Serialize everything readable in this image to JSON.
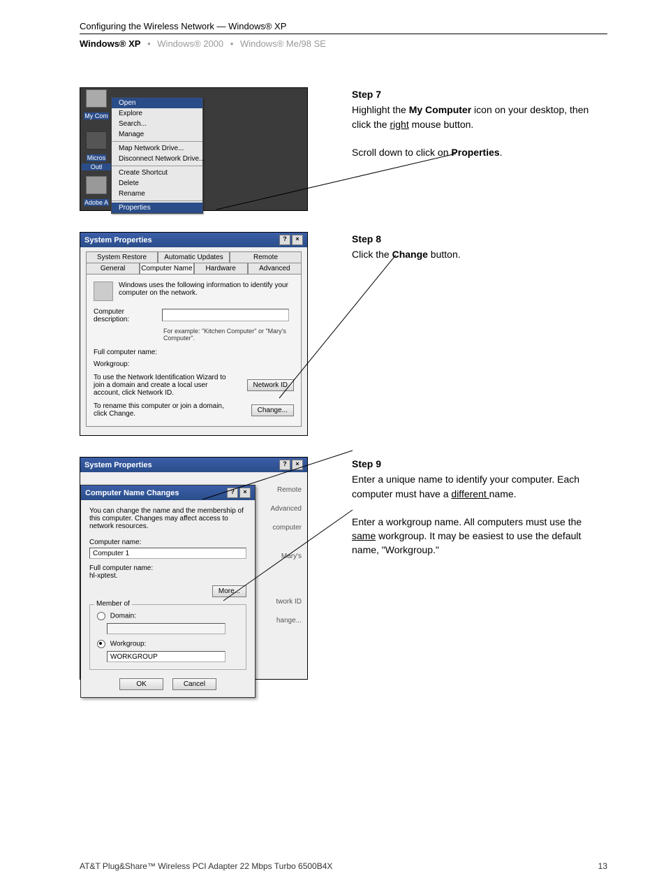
{
  "header": {
    "title": "Configuring the Wireless Network — Windows® XP",
    "tabs": {
      "active": "Windows® XP",
      "t2": "Windows® 2000",
      "t3": "Windows® Me/98 SE"
    }
  },
  "step7": {
    "title": "Step 7",
    "line1a": "Highlight the ",
    "line1b": "My Computer",
    "line1c": " icon on your desktop, then click the ",
    "line1d": "right",
    "line1e": " mouse button.",
    "line2a": "Scroll down to click on ",
    "line2b": "Properties",
    "line2c": "."
  },
  "step8": {
    "title": "Step 8",
    "line1a": "Click the ",
    "line1b": "Change",
    "line1c": " button."
  },
  "step9": {
    "title": "Step 9",
    "p1a": "Enter a unique name to identify your computer. Each computer must have a ",
    "p1b": "different ",
    "p1c": "name.",
    "p2a": "Enter a workgroup name. All computers must use the ",
    "p2b": "same",
    "p2c": " workgroup. It may be easiest to use the default name, \"Workgroup.\""
  },
  "scr1": {
    "icons": {
      "mycomp": "My Com",
      "micros": "Micros",
      "outlk": "Outl",
      "adobe": "Adobe A"
    },
    "menu": {
      "open": "Open",
      "explore": "Explore",
      "search": "Search...",
      "manage": "Manage",
      "mapdrive": "Map Network Drive...",
      "disconnect": "Disconnect Network Drive...",
      "shortcut": "Create Shortcut",
      "delete": "Delete",
      "rename": "Rename",
      "properties": "Properties"
    }
  },
  "scr2": {
    "title": "System Properties",
    "tabs1": {
      "sysrestore": "System Restore",
      "autoupd": "Automatic Updates",
      "remote": "Remote"
    },
    "tabs2": {
      "general": "General",
      "cname": "Computer Name",
      "hardware": "Hardware",
      "advanced": "Advanced"
    },
    "info": "Windows uses the following information to identify your computer on the network.",
    "desc_label": "Computer description:",
    "example": "For example: \"Kitchen Computer\" or \"Mary's Computer\".",
    "fullname_label": "Full computer name:",
    "workgroup_label": "Workgroup:",
    "nwidtext": "To use the Network Identification Wizard to join a domain and create a local user account, click Network ID.",
    "nwidbtn": "Network ID",
    "changetext": "To rename this computer or join a domain, click Change.",
    "changebtn": "Change..."
  },
  "scr3": {
    "title": "System Properties",
    "dlgtitle": "Computer Name Changes",
    "intro": "You can change the name and the membership of this computer. Changes may affect access to network resources.",
    "compname_label": "Computer name:",
    "compname_value": "Computer 1",
    "fullname_label": "Full computer name:",
    "fullname_value": "hl-xptest.",
    "more_btn": "More...",
    "memberof": "Member of",
    "domain_label": "Domain:",
    "workgroup_label": "Workgroup:",
    "workgroup_value": "WORKGROUP",
    "ok": "OK",
    "cancel": "Cancel",
    "back": {
      "remote": "Remote",
      "advanced": "Advanced",
      "computer": "computer",
      "marys": "Mary's",
      "nwid": "twork ID",
      "change": "hange..."
    }
  },
  "footer": {
    "left": "AT&T Plug&Share™ Wireless PCI Adapter 22 Mbps Turbo 6500B4X",
    "right": "13"
  }
}
